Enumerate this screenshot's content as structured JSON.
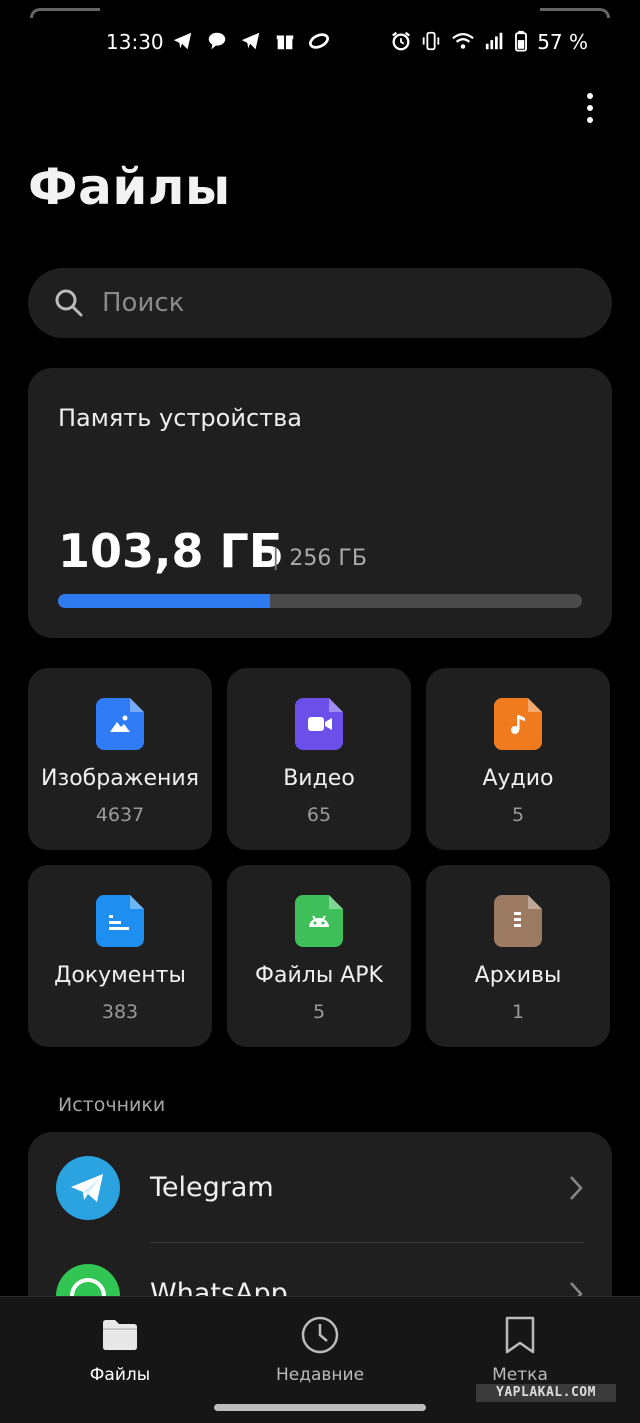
{
  "status_bar": {
    "time": "13:30",
    "battery": "57 %",
    "left_icons": [
      "telegram-icon",
      "chat-icon",
      "telegram-icon",
      "gift-icon",
      "ring-icon"
    ],
    "right_icons": [
      "alarm-icon",
      "vibrate-icon",
      "wifi-icon",
      "signal-icon",
      "battery-icon"
    ]
  },
  "header": {
    "title": "Файлы"
  },
  "search": {
    "placeholder": "Поиск"
  },
  "storage": {
    "title": "Память устройства",
    "used": "103,8 ГБ",
    "separator": "|",
    "total": "256 ГБ",
    "used_fraction": 0.405,
    "bar_color": "#2e7bf0"
  },
  "categories": [
    {
      "name": "Изображения",
      "count": "4637",
      "color": "#2f7cf6",
      "icon": "image-icon"
    },
    {
      "name": "Видео",
      "count": "65",
      "color": "#6a4fe8",
      "icon": "video-icon"
    },
    {
      "name": "Аудио",
      "count": "5",
      "color": "#f07a1e",
      "icon": "music-icon"
    },
    {
      "name": "Документы",
      "count": "383",
      "color": "#1e8ff0",
      "icon": "document-icon"
    },
    {
      "name": "Файлы APK",
      "count": "5",
      "color": "#3fbf5a",
      "icon": "android-icon"
    },
    {
      "name": "Архивы",
      "count": "1",
      "color": "#9c7a62",
      "icon": "archive-icon"
    }
  ],
  "sources": {
    "label": "Источники",
    "items": [
      {
        "name": "Telegram",
        "color": "#2aa3e0",
        "icon": "telegram-icon"
      },
      {
        "name": "WhatsApp",
        "color": "#31c553",
        "icon": "whatsapp-icon"
      }
    ]
  },
  "bottom_nav": {
    "items": [
      {
        "label": "Файлы",
        "icon": "folder-icon",
        "active": true
      },
      {
        "label": "Недавние",
        "icon": "clock-icon",
        "active": false
      },
      {
        "label": "Метка",
        "icon": "bookmark-icon",
        "active": false
      }
    ]
  },
  "watermark": "YAPLAKAL.COM"
}
